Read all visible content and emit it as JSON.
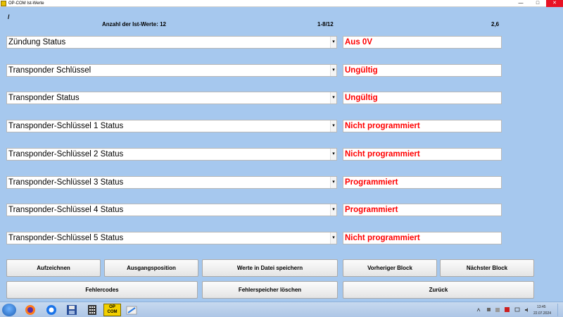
{
  "window": {
    "title": "OP-COM Ist-Werte"
  },
  "header": {
    "slash": "/",
    "count_label": "Anzahl der Ist-Werte: 12",
    "range": "1-8/12",
    "value": "2,6"
  },
  "rows": [
    {
      "label": "Zündung Status",
      "value": "Aus 0V"
    },
    {
      "label": "Transponder Schlüssel",
      "value": "Ungültig"
    },
    {
      "label": "Transponder Status",
      "value": "Ungültig"
    },
    {
      "label": "Transponder-Schlüssel 1 Status",
      "value": "Nicht programmiert"
    },
    {
      "label": "Transponder-Schlüssel 2 Status",
      "value": "Nicht programmiert"
    },
    {
      "label": "Transponder-Schlüssel 3 Status",
      "value": "Programmiert"
    },
    {
      "label": "Transponder-Schlüssel 4 Status",
      "value": "Programmiert"
    },
    {
      "label": "Transponder-Schlüssel 5 Status",
      "value": "Nicht programmiert"
    }
  ],
  "buttons": {
    "record": "Aufzeichnen",
    "start_position": "Ausgangsposition",
    "save_to_file": "Werte in Datei speichern",
    "previous_block": "Vorheriger Block",
    "next_block": "Nächster Block",
    "error_codes": "Fehlercodes",
    "clear_error_memory": "Fehlerspeicher löschen",
    "back": "Zurück"
  },
  "taskbar": {
    "opcom_line1": "OP",
    "opcom_line2": "COM",
    "time": "13:45",
    "date": "22.07.2024"
  },
  "colors": {
    "background": "#a6c8ee",
    "value_text": "#ff0000"
  }
}
